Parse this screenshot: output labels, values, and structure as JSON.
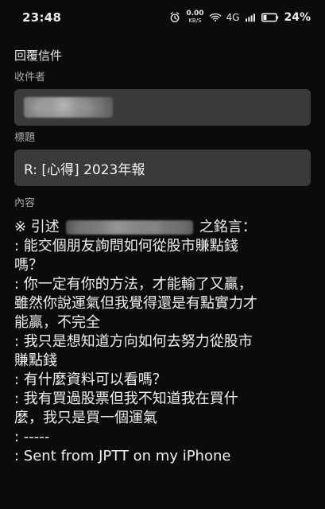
{
  "status_bar": {
    "time": "23:48",
    "network_speed_value": "0.00",
    "network_speed_unit": "KB/S",
    "network_type": "4G",
    "battery_percent": "24%"
  },
  "compose": {
    "title": "回覆信件",
    "recipient_label": "收件者",
    "subject_label": "標題",
    "subject_value": "R: [心得] 2023年報",
    "content_label": "內容"
  },
  "message_body": {
    "quote_prefix": "※ 引述",
    "quote_suffix": "之銘言：",
    "lines": [
      ": 能交個朋友詢問如何從股市賺點錢",
      "嗎？",
      ": 你一定有你的方法，才能輸了又贏，",
      "雖然你說運氣但我覺得還是有點實力才",
      "能贏，不完全",
      ": 我只是想知道方向如何去努力從股市",
      "賺點錢",
      ": 有什麼資料可以看嗎？",
      ": 我有買過股票但我不知道我在買什",
      "麼，我只是買一個運氣",
      ": -----",
      ": Sent from JPTT on my iPhone"
    ]
  },
  "icons": {
    "alarm": "alarm-icon",
    "wifi": "wifi-icon",
    "signal": "signal-icon",
    "battery": "battery-icon"
  }
}
